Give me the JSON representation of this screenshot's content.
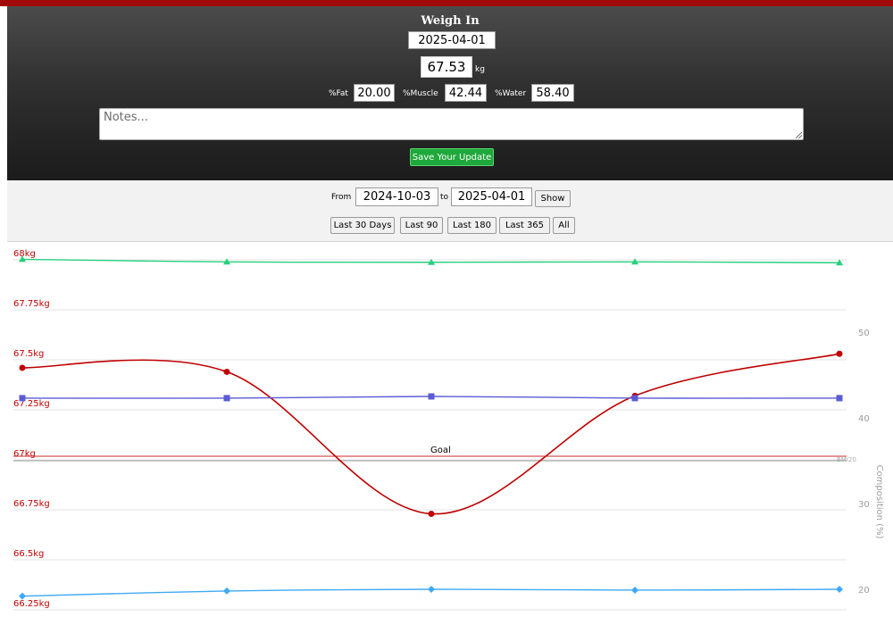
{
  "weigh_in": {
    "title": "Weigh In",
    "date": "2025-04-01",
    "weight": "67.53",
    "weight_unit": "kg",
    "fat_label": "%Fat",
    "fat": "20.00",
    "muscle_label": "%Muscle",
    "muscle": "42.44",
    "water_label": "%Water",
    "water": "58.40",
    "notes_placeholder": "Notes...",
    "save_label": "Save Your Update"
  },
  "date_range": {
    "from_label": "From",
    "from": "2024-10-03",
    "to_label": "to",
    "to": "2025-04-01",
    "show_label": "Show",
    "quick_ranges": [
      "Last 30 Days",
      "Last 90",
      "Last 180",
      "Last 365",
      "All"
    ]
  },
  "colors": {
    "header_bar": "#a30b0b",
    "weight": "#c00000",
    "water": "#26d07c",
    "muscle": "#5b5bd6",
    "fat": "#3fa9f5",
    "save_button": "#1fa83b"
  },
  "chart_data": {
    "type": "line",
    "y_left": {
      "ticks": [
        "66.25kg",
        "66.5kg",
        "66.75kg",
        "67kg",
        "67.25kg",
        "67.5kg",
        "67.75kg",
        "68kg"
      ],
      "range": [
        66.25,
        68
      ]
    },
    "y_right": {
      "label": "Composition (%)",
      "ticks": [
        "20",
        "30",
        "40",
        "50"
      ],
      "range": [
        19.8,
        60.3
      ]
    },
    "goal": {
      "label": "Goal",
      "value": 67,
      "right_label": "BMI20"
    },
    "series": [
      {
        "key": "water",
        "axis": "right",
        "marker": "triangle",
        "values": [
          58.5,
          58.2,
          58.15,
          58.2,
          58.1
        ]
      },
      {
        "key": "weight",
        "axis": "left",
        "marker": "circle",
        "values": [
          67.46,
          67.44,
          66.73,
          67.32,
          67.53
        ]
      },
      {
        "key": "muscle",
        "axis": "right",
        "marker": "square",
        "values": [
          42.3,
          42.3,
          42.5,
          42.3,
          42.3
        ]
      },
      {
        "key": "fat",
        "axis": "right",
        "marker": "diamond",
        "values": [
          19.2,
          19.8,
          20.0,
          19.9,
          20.0
        ]
      }
    ]
  }
}
